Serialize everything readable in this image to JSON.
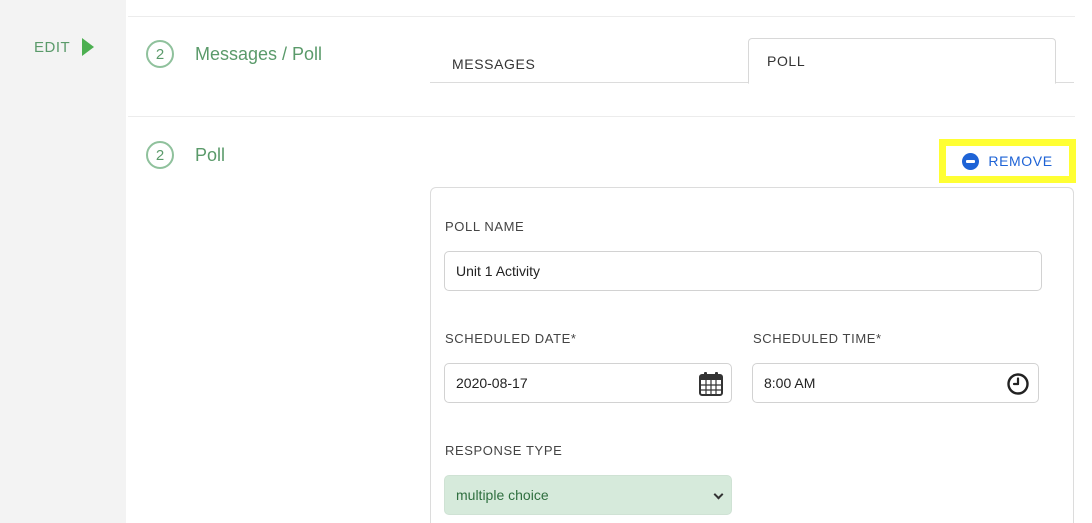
{
  "left_rail": {
    "edit_label": "EDIT"
  },
  "section_messages_poll": {
    "step": "2",
    "title": "Messages / Poll"
  },
  "tabs": [
    {
      "label": "MESSAGES",
      "active": false
    },
    {
      "label": "POLL",
      "active": true
    }
  ],
  "section_poll": {
    "step": "2",
    "title": "Poll"
  },
  "remove_button": {
    "label": "REMOVE"
  },
  "form": {
    "poll_name": {
      "label": "POLL NAME",
      "value": "Unit 1 Activity"
    },
    "scheduled_date": {
      "label": "SCHEDULED DATE*",
      "value": "2020-08-17"
    },
    "scheduled_time": {
      "label": "SCHEDULED TIME*",
      "value": "8:00 AM"
    },
    "response_type": {
      "label": "RESPONSE TYPE",
      "value": "multiple choice"
    }
  },
  "colors": {
    "accent_green": "#5a9a6a",
    "link_blue": "#1e63d6",
    "highlight": "#ffff33",
    "select_bg": "#d6eadb"
  },
  "icons": [
    "play-arrow-icon",
    "minus-circle-icon",
    "calendar-icon",
    "clock-icon",
    "chevron-down-icon"
  ]
}
